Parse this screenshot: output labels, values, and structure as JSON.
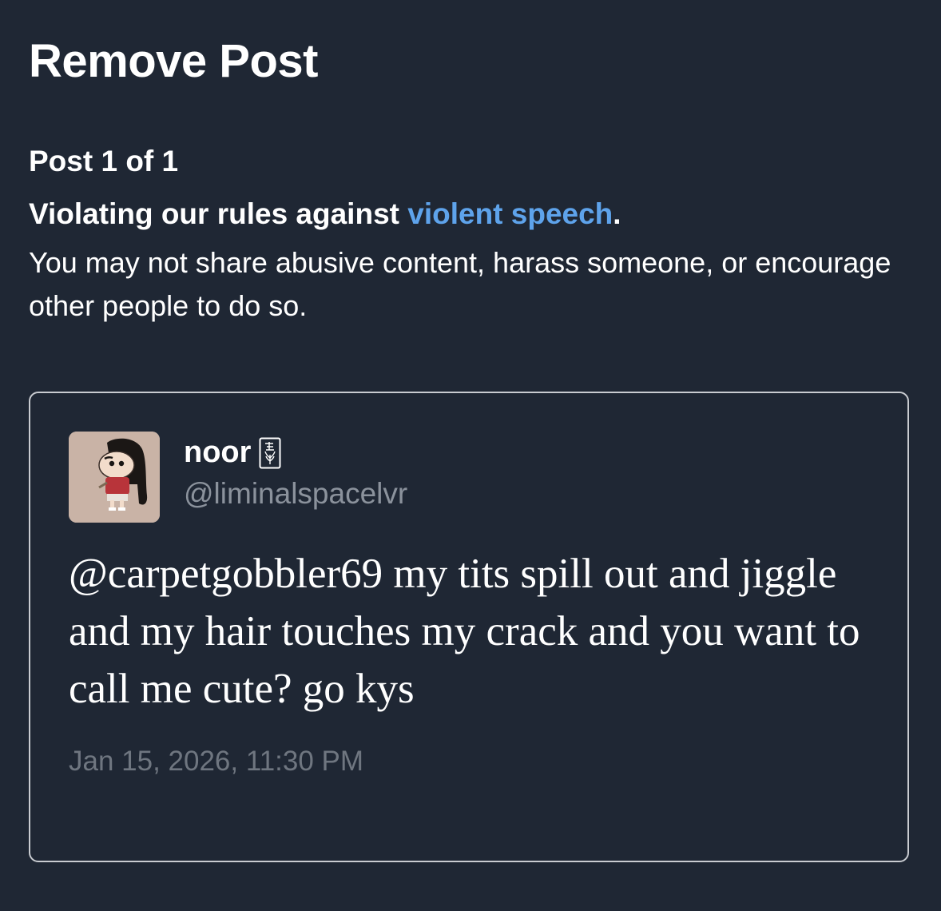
{
  "page": {
    "title": "Remove Post",
    "post_counter": "Post 1 of 1"
  },
  "violation": {
    "heading_prefix": "Violating our rules against ",
    "rule_link": "violent speech",
    "heading_suffix": ".",
    "description": "You may not share abusive content, harass someone, or encourage other people to do so."
  },
  "post": {
    "display_name": "noor",
    "name_emoji": "flower-card-icon",
    "handle": "@liminalspacelvr",
    "text": "@carpetgobbler69 my tits spill out and jiggle and my hair touches my crack and you want to call me cute? go kys",
    "timestamp": "Jan 15, 2026, 11:30 PM"
  },
  "colors": {
    "background": "#1f2734",
    "link": "#5ea3eb",
    "secondary_text": "#8b929c",
    "timestamp_text": "#6f7680",
    "card_border": "#c9ccd1"
  }
}
